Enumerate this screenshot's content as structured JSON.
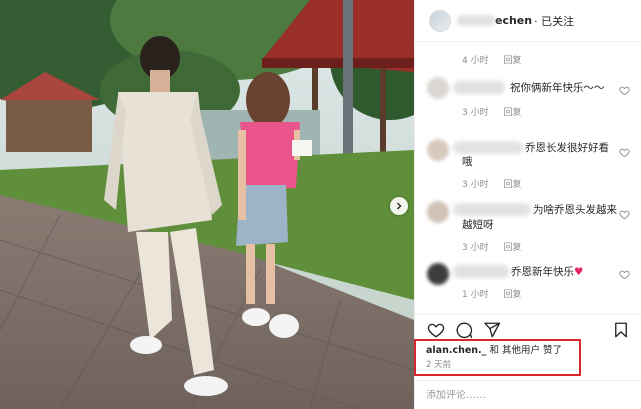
{
  "post": {
    "username_visible": "echen",
    "follow_status": "· 已关注"
  },
  "comments": [
    {
      "text": "",
      "time": "4 小时",
      "reply": "回复"
    },
    {
      "text": "祝你俩新年快乐～～",
      "time": "3 小时",
      "reply": "回复"
    },
    {
      "text": "乔恩长发很好好看",
      "text2": "哦",
      "time": "3 小时",
      "reply": "回复"
    },
    {
      "text": "为啥乔恩头发越来",
      "text2": "越短呀",
      "time": "3 小时",
      "reply": "回复"
    },
    {
      "text": "乔恩新年快乐",
      "heart": "♥",
      "time": "1 小时",
      "reply": "回复"
    }
  ],
  "actions": {
    "like_icon": "heart-outline-icon",
    "comment_icon": "speech-bubble-icon",
    "share_icon": "paper-plane-icon",
    "save_icon": "bookmark-icon"
  },
  "likes": {
    "user": "alan.chen._",
    "text": " 和 其他用户 赞了"
  },
  "post_time": "2 天前",
  "add_comment": {
    "placeholder": "添加评论……"
  },
  "colors": {
    "highlight_border": "#d9262c",
    "heart": "#e0245e",
    "meta": "#8e8e8e"
  }
}
